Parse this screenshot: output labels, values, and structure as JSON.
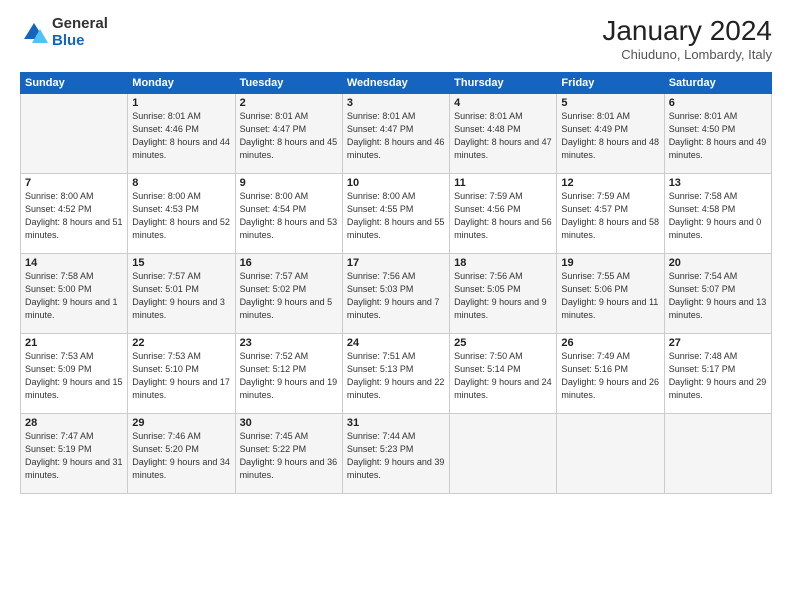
{
  "header": {
    "logo_general": "General",
    "logo_blue": "Blue",
    "main_title": "January 2024",
    "sub_title": "Chiuduno, Lombardy, Italy"
  },
  "calendar": {
    "days_header": [
      "Sunday",
      "Monday",
      "Tuesday",
      "Wednesday",
      "Thursday",
      "Friday",
      "Saturday"
    ],
    "weeks": [
      [
        {
          "day": "",
          "info": ""
        },
        {
          "day": "1",
          "info": "Sunrise: 8:01 AM\nSunset: 4:46 PM\nDaylight: 8 hours\nand 44 minutes."
        },
        {
          "day": "2",
          "info": "Sunrise: 8:01 AM\nSunset: 4:47 PM\nDaylight: 8 hours\nand 45 minutes."
        },
        {
          "day": "3",
          "info": "Sunrise: 8:01 AM\nSunset: 4:47 PM\nDaylight: 8 hours\nand 46 minutes."
        },
        {
          "day": "4",
          "info": "Sunrise: 8:01 AM\nSunset: 4:48 PM\nDaylight: 8 hours\nand 47 minutes."
        },
        {
          "day": "5",
          "info": "Sunrise: 8:01 AM\nSunset: 4:49 PM\nDaylight: 8 hours\nand 48 minutes."
        },
        {
          "day": "6",
          "info": "Sunrise: 8:01 AM\nSunset: 4:50 PM\nDaylight: 8 hours\nand 49 minutes."
        }
      ],
      [
        {
          "day": "7",
          "info": "Sunrise: 8:00 AM\nSunset: 4:52 PM\nDaylight: 8 hours\nand 51 minutes."
        },
        {
          "day": "8",
          "info": "Sunrise: 8:00 AM\nSunset: 4:53 PM\nDaylight: 8 hours\nand 52 minutes."
        },
        {
          "day": "9",
          "info": "Sunrise: 8:00 AM\nSunset: 4:54 PM\nDaylight: 8 hours\nand 53 minutes."
        },
        {
          "day": "10",
          "info": "Sunrise: 8:00 AM\nSunset: 4:55 PM\nDaylight: 8 hours\nand 55 minutes."
        },
        {
          "day": "11",
          "info": "Sunrise: 7:59 AM\nSunset: 4:56 PM\nDaylight: 8 hours\nand 56 minutes."
        },
        {
          "day": "12",
          "info": "Sunrise: 7:59 AM\nSunset: 4:57 PM\nDaylight: 8 hours\nand 58 minutes."
        },
        {
          "day": "13",
          "info": "Sunrise: 7:58 AM\nSunset: 4:58 PM\nDaylight: 9 hours\nand 0 minutes."
        }
      ],
      [
        {
          "day": "14",
          "info": "Sunrise: 7:58 AM\nSunset: 5:00 PM\nDaylight: 9 hours\nand 1 minute."
        },
        {
          "day": "15",
          "info": "Sunrise: 7:57 AM\nSunset: 5:01 PM\nDaylight: 9 hours\nand 3 minutes."
        },
        {
          "day": "16",
          "info": "Sunrise: 7:57 AM\nSunset: 5:02 PM\nDaylight: 9 hours\nand 5 minutes."
        },
        {
          "day": "17",
          "info": "Sunrise: 7:56 AM\nSunset: 5:03 PM\nDaylight: 9 hours\nand 7 minutes."
        },
        {
          "day": "18",
          "info": "Sunrise: 7:56 AM\nSunset: 5:05 PM\nDaylight: 9 hours\nand 9 minutes."
        },
        {
          "day": "19",
          "info": "Sunrise: 7:55 AM\nSunset: 5:06 PM\nDaylight: 9 hours\nand 11 minutes."
        },
        {
          "day": "20",
          "info": "Sunrise: 7:54 AM\nSunset: 5:07 PM\nDaylight: 9 hours\nand 13 minutes."
        }
      ],
      [
        {
          "day": "21",
          "info": "Sunrise: 7:53 AM\nSunset: 5:09 PM\nDaylight: 9 hours\nand 15 minutes."
        },
        {
          "day": "22",
          "info": "Sunrise: 7:53 AM\nSunset: 5:10 PM\nDaylight: 9 hours\nand 17 minutes."
        },
        {
          "day": "23",
          "info": "Sunrise: 7:52 AM\nSunset: 5:12 PM\nDaylight: 9 hours\nand 19 minutes."
        },
        {
          "day": "24",
          "info": "Sunrise: 7:51 AM\nSunset: 5:13 PM\nDaylight: 9 hours\nand 22 minutes."
        },
        {
          "day": "25",
          "info": "Sunrise: 7:50 AM\nSunset: 5:14 PM\nDaylight: 9 hours\nand 24 minutes."
        },
        {
          "day": "26",
          "info": "Sunrise: 7:49 AM\nSunset: 5:16 PM\nDaylight: 9 hours\nand 26 minutes."
        },
        {
          "day": "27",
          "info": "Sunrise: 7:48 AM\nSunset: 5:17 PM\nDaylight: 9 hours\nand 29 minutes."
        }
      ],
      [
        {
          "day": "28",
          "info": "Sunrise: 7:47 AM\nSunset: 5:19 PM\nDaylight: 9 hours\nand 31 minutes."
        },
        {
          "day": "29",
          "info": "Sunrise: 7:46 AM\nSunset: 5:20 PM\nDaylight: 9 hours\nand 34 minutes."
        },
        {
          "day": "30",
          "info": "Sunrise: 7:45 AM\nSunset: 5:22 PM\nDaylight: 9 hours\nand 36 minutes."
        },
        {
          "day": "31",
          "info": "Sunrise: 7:44 AM\nSunset: 5:23 PM\nDaylight: 9 hours\nand 39 minutes."
        },
        {
          "day": "",
          "info": ""
        },
        {
          "day": "",
          "info": ""
        },
        {
          "day": "",
          "info": ""
        }
      ]
    ]
  }
}
